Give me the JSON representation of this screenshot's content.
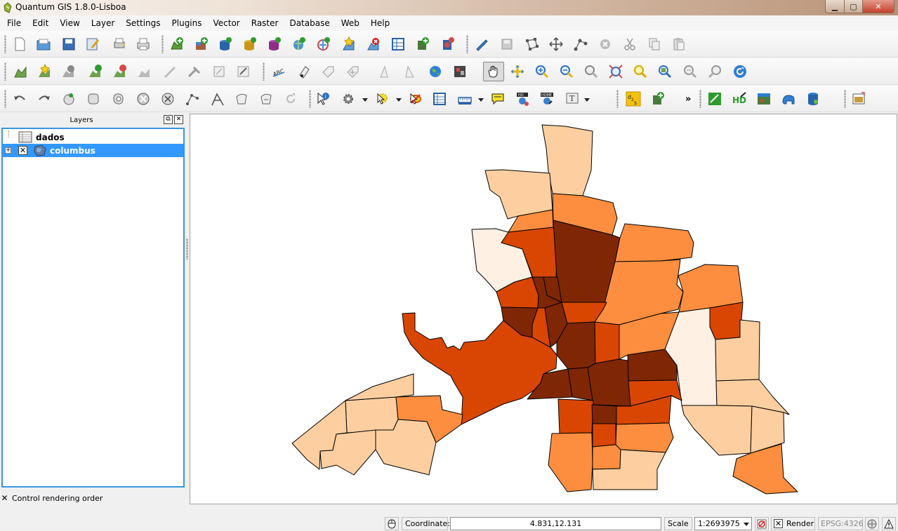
{
  "window": {
    "title": "Quantum GIS 1.8.0-Lisboa",
    "min_glyph": "▁",
    "max_glyph": "▢",
    "close_glyph": "✕"
  },
  "menu": [
    "File",
    "Edit",
    "View",
    "Layer",
    "Settings",
    "Plugins",
    "Vector",
    "Raster",
    "Database",
    "Web",
    "Help"
  ],
  "toolbar_overflow": "»",
  "layers_panel": {
    "title": "Layers",
    "float_glyph": "⧉",
    "close_glyph": "✕",
    "layers": [
      {
        "name": "dados",
        "type": "table",
        "selected": false
      },
      {
        "name": "columbus",
        "type": "vector-polygon",
        "selected": true,
        "visible": true,
        "expander": "+",
        "check": "✕"
      }
    ],
    "control_rendering_order": {
      "label": "Control rendering order",
      "check": "✕"
    }
  },
  "statusbar": {
    "coordinate_label": "Coordinate:",
    "coordinate_value": "4.831,12.131",
    "scale_label": "Scale",
    "scale_value": "1:2693975",
    "render_label": "Render",
    "render_check": "✕",
    "crs": "EPSG:4326"
  },
  "map": {
    "layer": "columbus",
    "palette": [
      "#fef0e3",
      "#fdcfa0",
      "#fd8e3f",
      "#d94601",
      "#7f2704"
    ],
    "outline": "#000000"
  }
}
